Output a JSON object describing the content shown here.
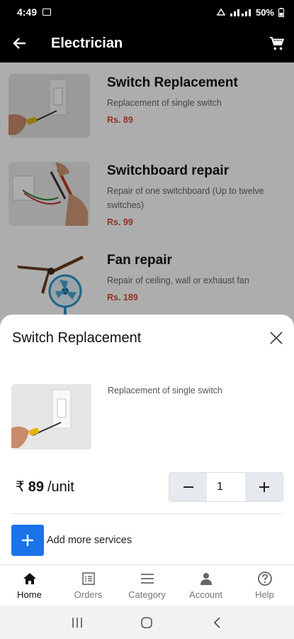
{
  "status_bar": {
    "time": "4:49",
    "battery": "50%"
  },
  "app_bar": {
    "title": "Electrician"
  },
  "services": [
    {
      "name": "Switch Replacement",
      "description": "Replacement of single switch",
      "price": "Rs. 89",
      "image_icon": "switch-image"
    },
    {
      "name": "Switchboard repair",
      "description": "Repair of one switchboard (Up to twelve switches)",
      "price": "Rs. 99",
      "image_icon": "switchboard-image"
    },
    {
      "name": "Fan repair",
      "description": "Repair of ceiling, wall or exhaust fan",
      "price": "Rs. 189",
      "image_icon": "fan-image"
    }
  ],
  "sheet": {
    "title": "Switch Replacement",
    "description": "Replacement of single switch",
    "currency": "₹",
    "amount": "89",
    "unit": "/unit",
    "quantity": "1",
    "add_more_label": "Add more services"
  },
  "bottom_nav": [
    {
      "label": "Home",
      "icon": "home-icon",
      "active": true
    },
    {
      "label": "Orders",
      "icon": "orders-icon",
      "active": false
    },
    {
      "label": "Category",
      "icon": "category-icon",
      "active": false
    },
    {
      "label": "Account",
      "icon": "account-icon",
      "active": false
    },
    {
      "label": "Help",
      "icon": "help-icon",
      "active": false
    }
  ],
  "colors": {
    "accent_blue": "#1a73e8",
    "price_red": "#d94a3a",
    "app_bar": "#000000"
  }
}
